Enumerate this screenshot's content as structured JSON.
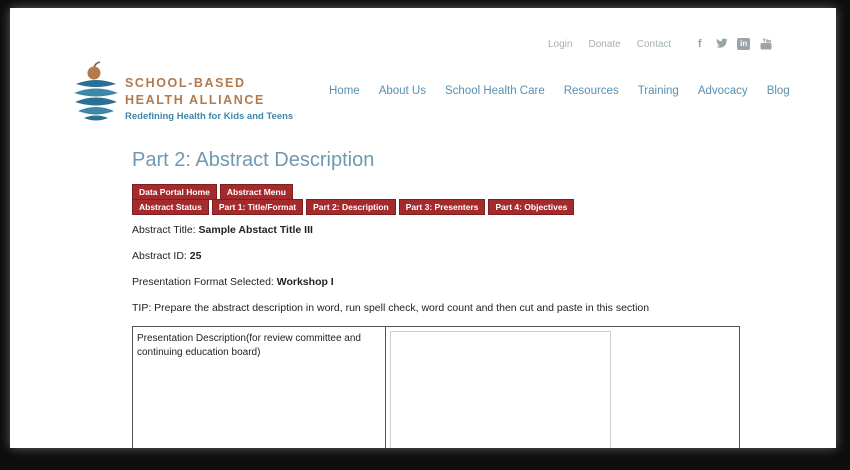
{
  "utility_nav": [
    "Login",
    "Donate",
    "Contact"
  ],
  "social_icons": [
    "facebook-icon",
    "twitter-icon",
    "linkedin-icon",
    "youtube-icon"
  ],
  "logo": {
    "line1": "SCHOOL-BASED",
    "line2": "HEALTH ALLIANCE",
    "tagline": "Redefining Health for Kids and Teens",
    "colors": {
      "text": "#b27a4d",
      "tagline": "#3f87a8",
      "swirl": "#2b6f94",
      "apple": "#b27a4d"
    }
  },
  "main_nav": [
    "Home",
    "About Us",
    "School Health Care",
    "Resources",
    "Training",
    "Advocacy",
    "Blog"
  ],
  "page_title": "Part 2: Abstract Description",
  "buttons_row1": [
    "Data Portal Home",
    "Abstract Menu"
  ],
  "buttons_row2": [
    "Abstract Status",
    "Part 1: Title/Format",
    "Part 2: Description",
    "Part 3: Presenters",
    "Part 4: Objectives"
  ],
  "abstract_title": {
    "label": "Abstract Title: ",
    "value": "Sample Abstact Title III"
  },
  "abstract_id": {
    "label": "Abstract ID: ",
    "value": "25"
  },
  "presentation_format": {
    "label": "Presentation Format Selected: ",
    "value": "Workshop I"
  },
  "tip": "TIP: Prepare the abstract description in word, run spell check, word count and then cut and paste in this section",
  "form": {
    "label": "Presentation Description(for review committee and continuing education board)",
    "value": ""
  },
  "colors": {
    "button_bg": "#a42a2c",
    "title": "#6f98b2",
    "nav": "#5a8fb0"
  }
}
